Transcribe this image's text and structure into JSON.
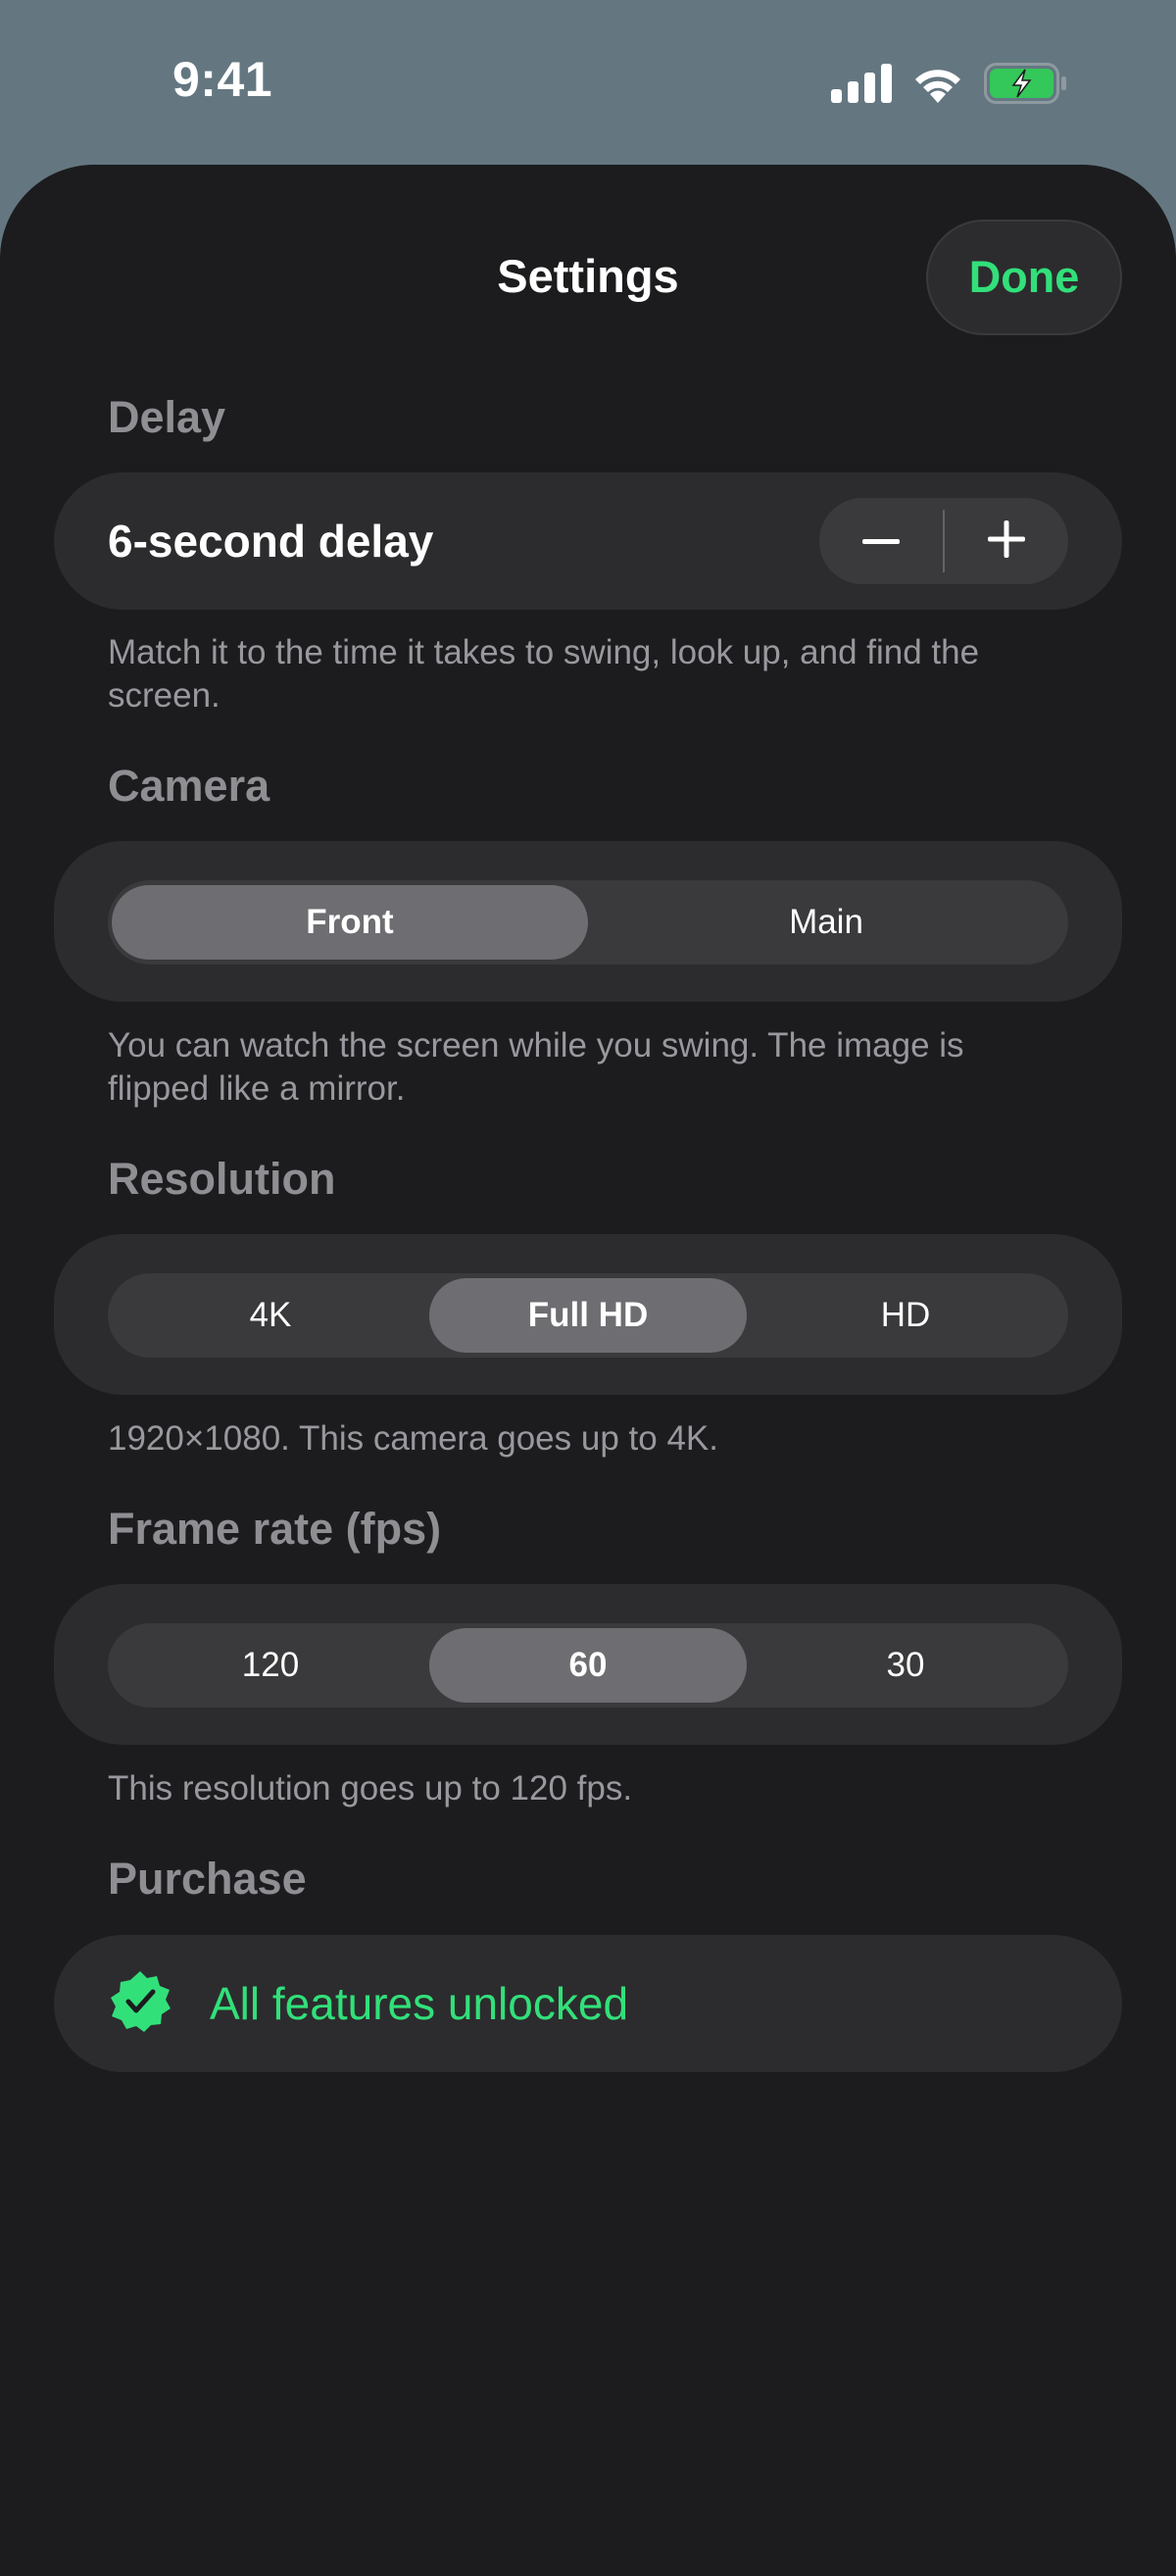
{
  "status_bar": {
    "time": "9:41"
  },
  "header": {
    "title": "Settings",
    "done_label": "Done"
  },
  "delay": {
    "section_title": "Delay",
    "value_label": "6-second delay",
    "footnote": "Match it to the time it takes to swing, look up, and find the screen."
  },
  "camera": {
    "section_title": "Camera",
    "options": [
      "Front",
      "Main"
    ],
    "selected": "Front",
    "footnote": "You can watch the screen while you swing. The image is flipped like a mirror."
  },
  "resolution": {
    "section_title": "Resolution",
    "options": [
      "4K",
      "Full HD",
      "HD"
    ],
    "selected": "Full HD",
    "footnote": "1920×1080. This camera goes up to 4K."
  },
  "frame_rate": {
    "section_title": "Frame rate (fps)",
    "options": [
      "120",
      "60",
      "30"
    ],
    "selected": "60",
    "footnote": "This resolution goes up to 120 fps."
  },
  "purchase": {
    "section_title": "Purchase",
    "status_label": "All features unlocked"
  },
  "colors": {
    "accent_green": "#32e07a",
    "sheet_background": "#1c1c1e",
    "card_background": "#2c2c2e",
    "backdrop": "#647781"
  }
}
